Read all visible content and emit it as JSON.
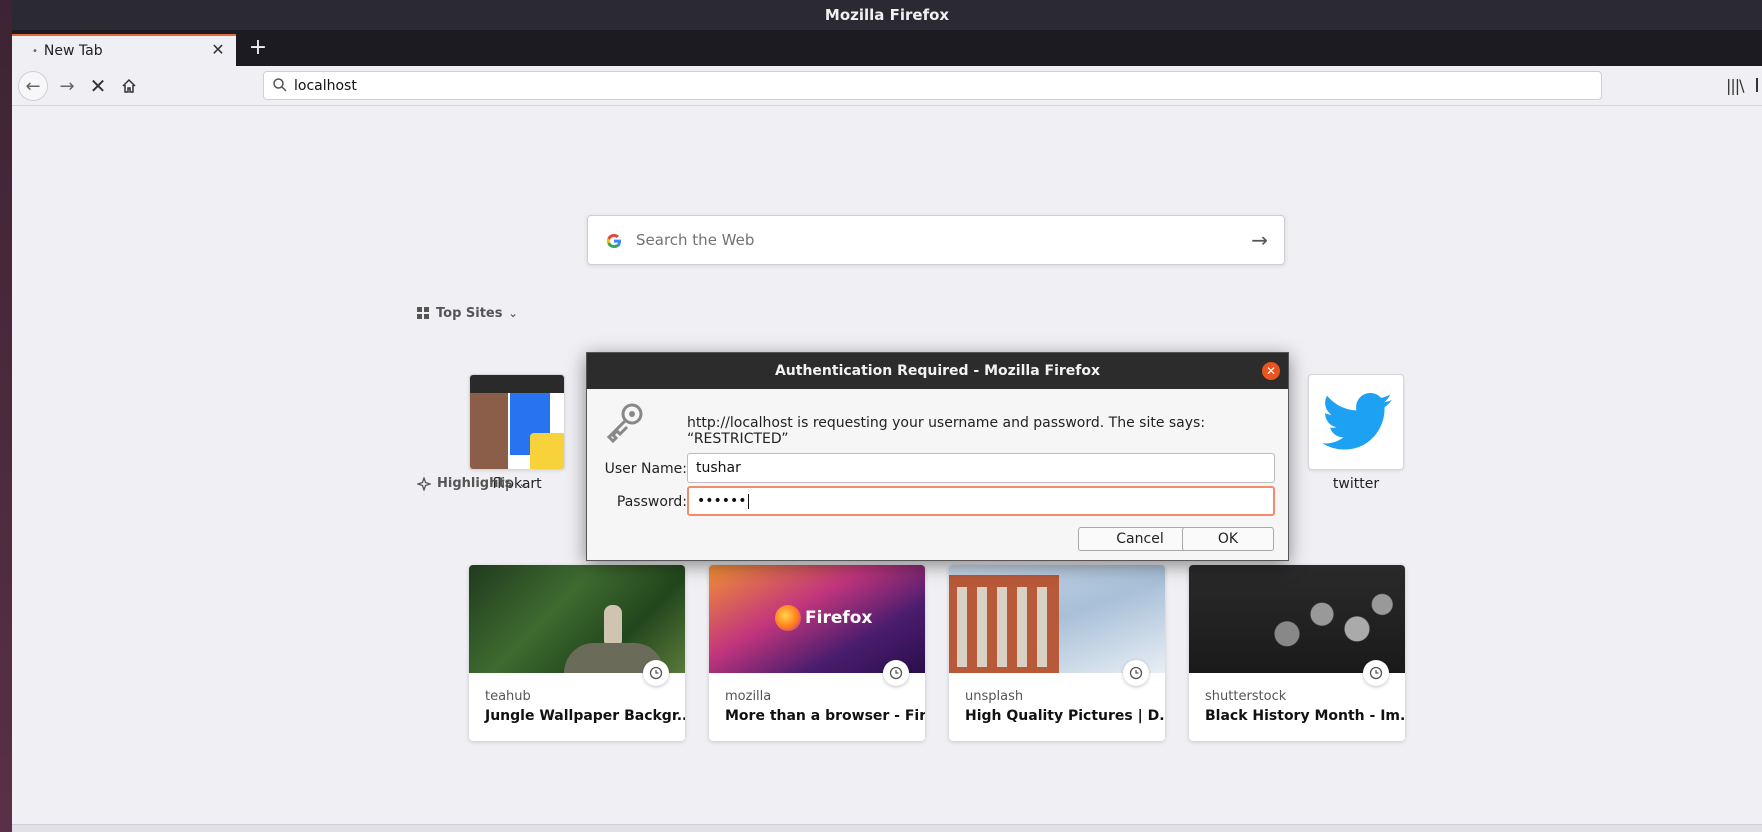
{
  "window": {
    "title": "Mozilla Firefox"
  },
  "tabs": [
    {
      "label": "New Tab"
    }
  ],
  "toolbar": {
    "url": "localhost"
  },
  "newtab": {
    "search": {
      "placeholder": "Search the Web"
    },
    "top_sites": {
      "header": "Top Sites",
      "items": [
        {
          "label": "flipkart"
        },
        {
          "label": "twitter"
        }
      ]
    },
    "highlights": {
      "header": "Highlights",
      "items": [
        {
          "source": "teahub",
          "title": "Jungle Wallpaper Backgr..."
        },
        {
          "source": "mozilla",
          "title": "More than a browser - Fir...",
          "image_text": "Firefox"
        },
        {
          "source": "unsplash",
          "title": "High Quality Pictures | D..."
        },
        {
          "source": "shutterstock",
          "title": "Black History Month - Im..."
        }
      ]
    }
  },
  "dialog": {
    "title": "Authentication Required - Mozilla Firefox",
    "message": "http://localhost is requesting your username and password. The site says: “RESTRICTED”",
    "username_label": "User Name:",
    "username_value": "tushar",
    "password_label": "Password:",
    "password_value": "••••••",
    "cancel_label": "Cancel",
    "ok_label": "OK"
  },
  "colors": {
    "accent": "#e66b3a",
    "dialog_close": "#e9541f",
    "twitter_blue": "#1da1f2"
  },
  "icons": [
    "back-icon",
    "forward-icon",
    "stop-icon",
    "home-icon",
    "search-icon",
    "google-icon",
    "arrow-right-icon",
    "grid-icon",
    "highlights-icon",
    "clock-icon",
    "key-icon",
    "close-icon",
    "library-icon"
  ]
}
